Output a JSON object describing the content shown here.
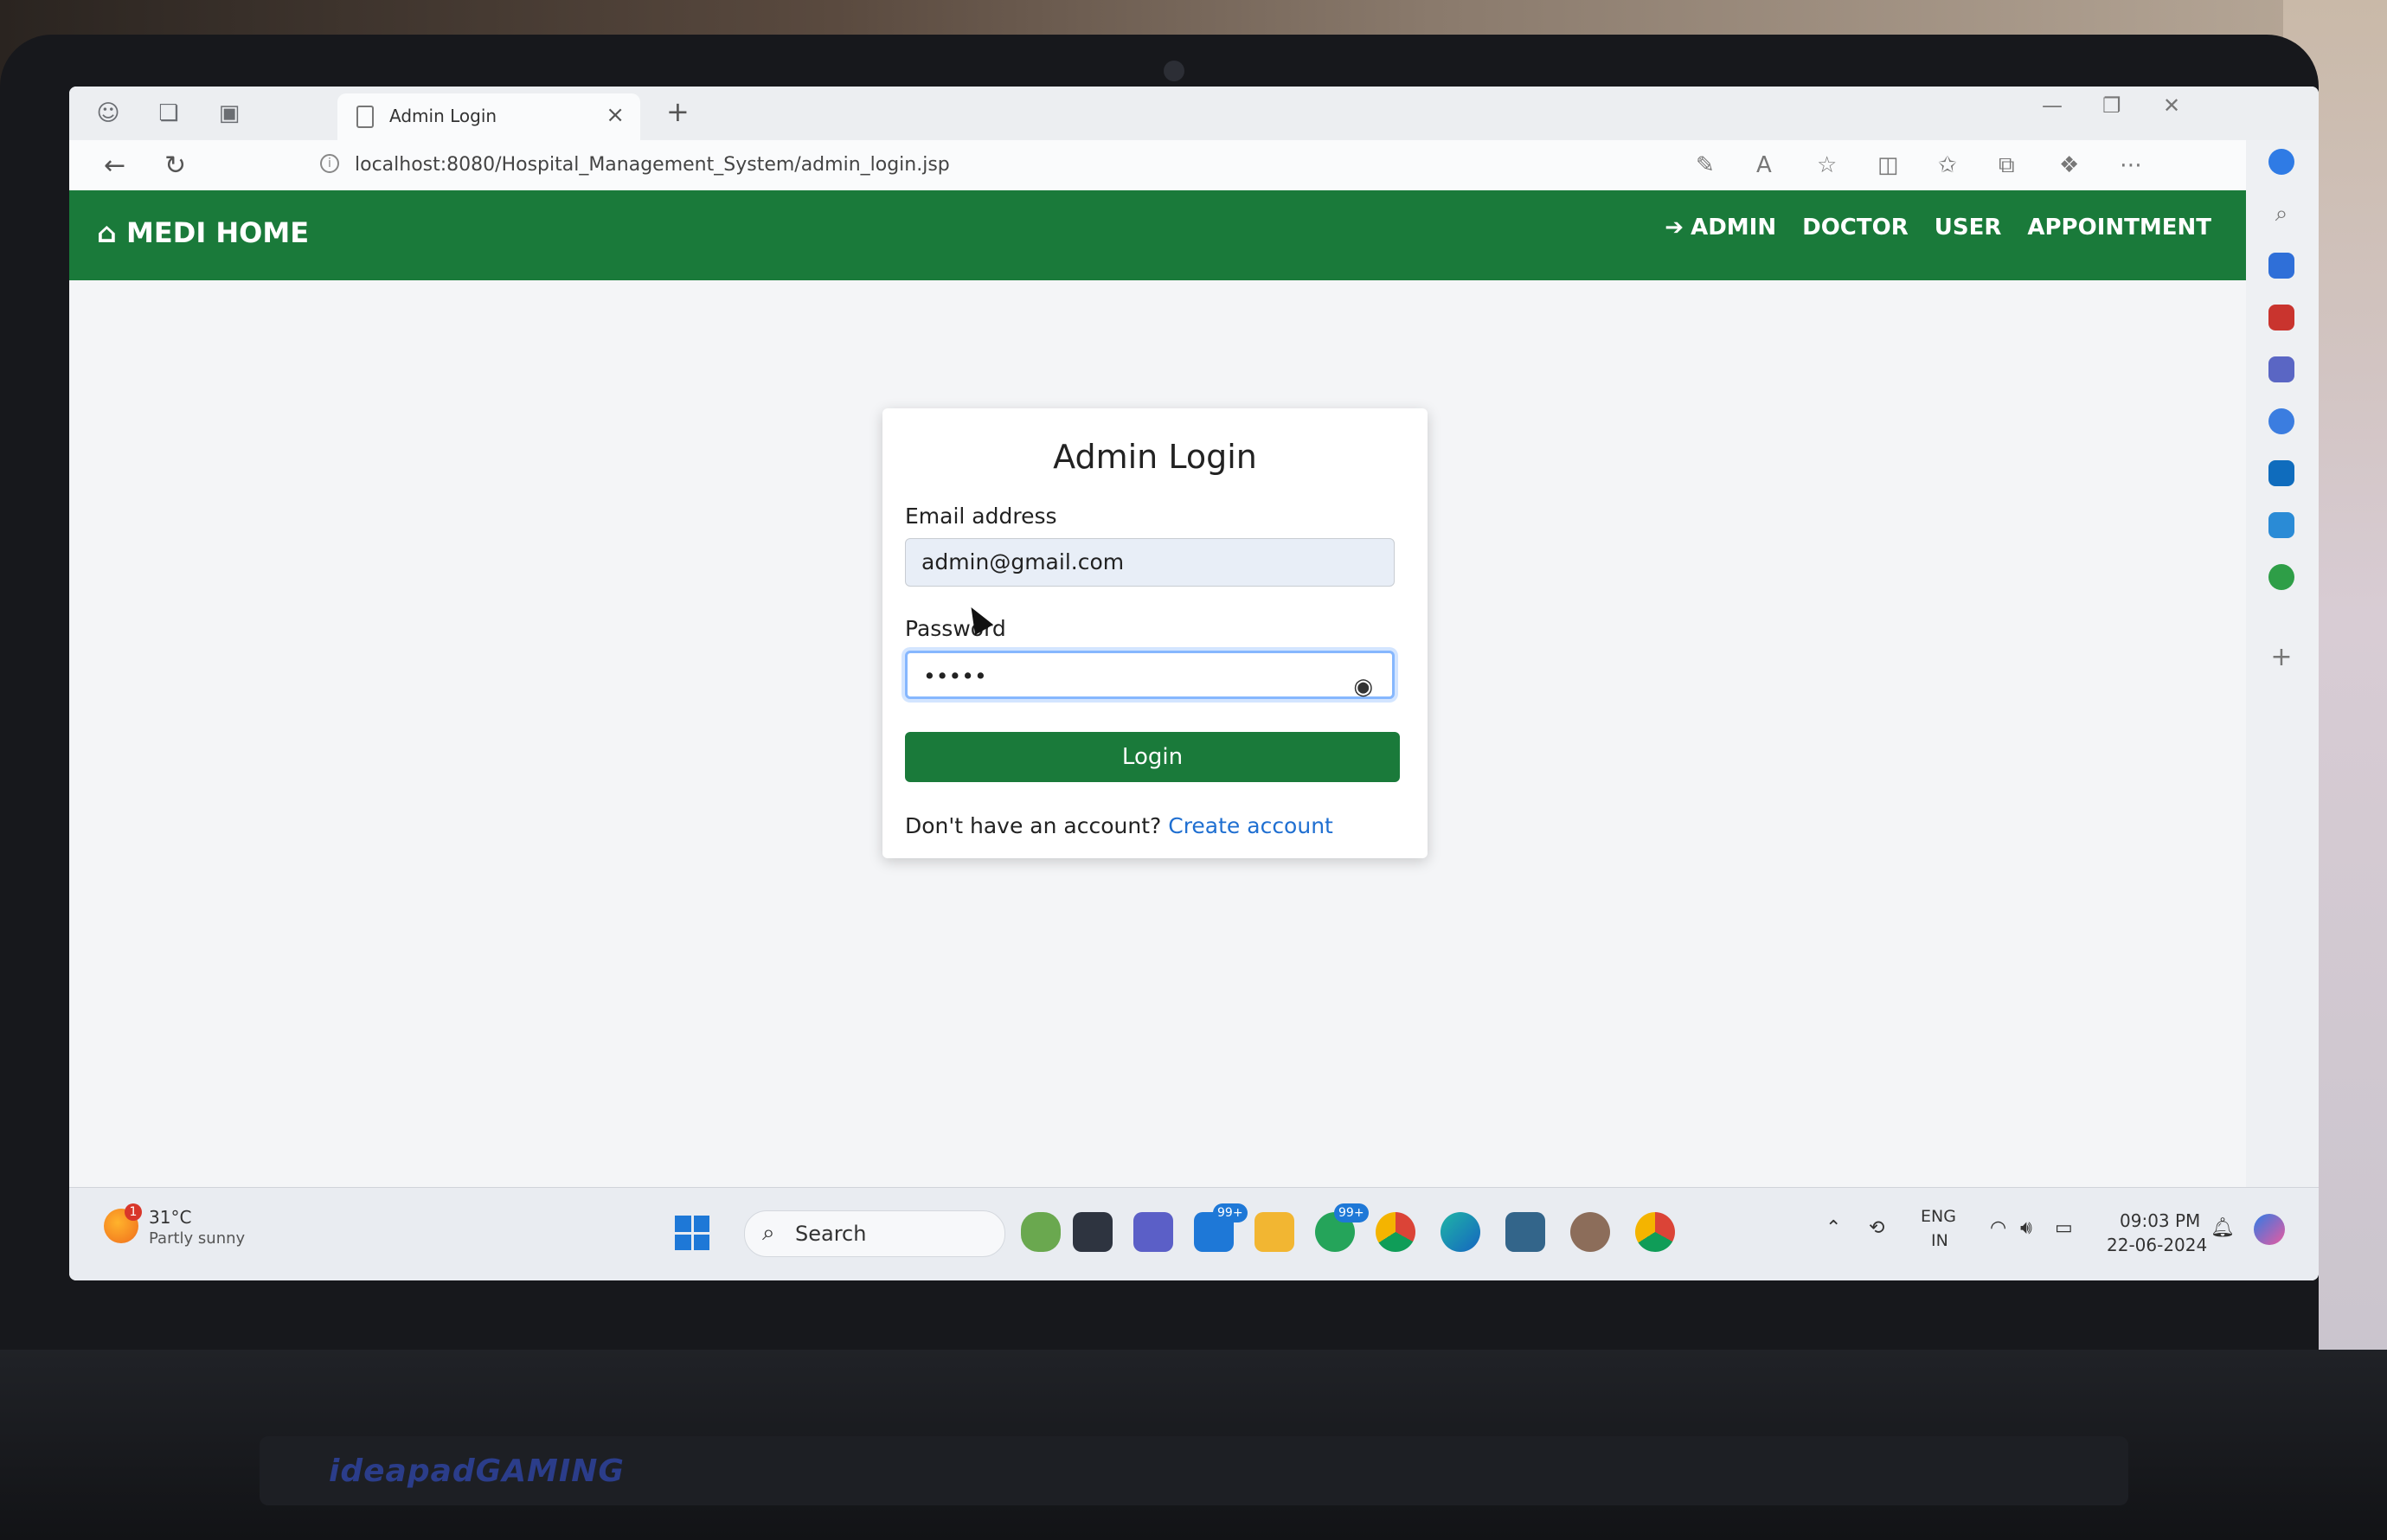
{
  "browser": {
    "tab_title": "Admin Login",
    "tab_close": "×",
    "new_tab": "+",
    "url": "localhost:8080/Hospital_Management_System/admin_login.jsp"
  },
  "navbar": {
    "brand": "MEDI HOME",
    "links": [
      "ADMIN",
      "DOCTOR",
      "USER",
      "APPOINTMENT"
    ]
  },
  "login_form": {
    "title": "Admin Login",
    "email_label": "Email address",
    "email_value": "admin@gmail.com",
    "password_label": "Password",
    "password_value": "•••••",
    "submit_label": "Login",
    "signup_prompt": "Don't have an account?",
    "signup_link": "Create account"
  },
  "taskbar": {
    "temperature": "31°C",
    "weather": "Partly sunny",
    "weather_alert": "1",
    "search_label": "Search",
    "mail_badge": "99+",
    "whatsapp_badge": "99+",
    "language": "ENG",
    "region": "IN",
    "time": "09:03 PM",
    "date": "22-06-2024"
  },
  "device": {
    "brand": "ideapadGAMING"
  },
  "colors": {
    "primary_green": "#1a7a3a",
    "link_blue": "#1f6fd1",
    "focus_blue": "#86b7fe"
  }
}
